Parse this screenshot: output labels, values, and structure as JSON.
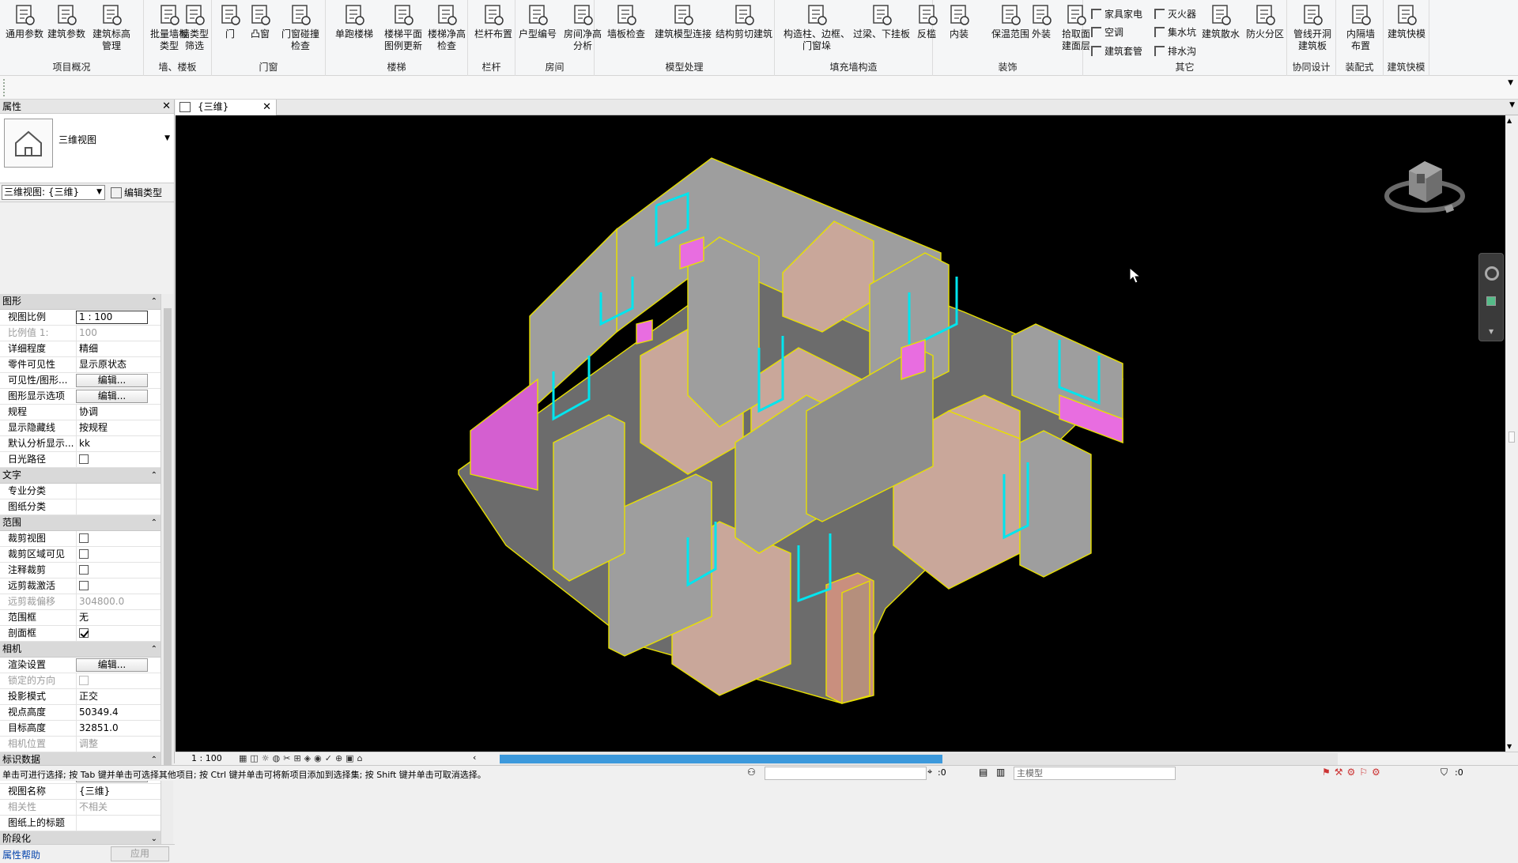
{
  "ribbon": {
    "groups": [
      {
        "label": "项目概况",
        "buttons": [
          "通用参数",
          "建筑参数",
          "建筑标高\n管理"
        ]
      },
      {
        "label": "墙、楼板",
        "buttons": [
          "批量墙板\n类型",
          "墙类型\n筛选"
        ]
      },
      {
        "label": "门窗",
        "buttons": [
          "门",
          "凸窗",
          "门窗碰撞\n检查"
        ]
      },
      {
        "label": "楼梯",
        "buttons": [
          "单跑楼梯",
          "楼梯平面\n图例更新",
          "楼梯净高\n检查"
        ]
      },
      {
        "label": "栏杆",
        "buttons": [
          "栏杆布置"
        ]
      },
      {
        "label": "房间",
        "buttons": [
          "户型编号",
          "房间净高\n分析"
        ]
      },
      {
        "label": "模型处理",
        "buttons": [
          "墙板检查",
          "建筑模型连接",
          "结构剪切建筑"
        ]
      },
      {
        "label": "填充墙构造",
        "buttons": [
          "构造柱、边框、\n门窗垛",
          "过梁、下挂板",
          "反槛"
        ]
      },
      {
        "label": "装饰",
        "buttons": [
          "内装",
          "保温范围",
          "外装",
          "拾取面\n建面层"
        ]
      },
      {
        "label": "其它",
        "small": [
          "家具家电",
          "空调",
          "建筑套管",
          "灭火器",
          "集水坑",
          "排水沟"
        ],
        "buttons": [
          "建筑散水",
          "防火分区"
        ]
      },
      {
        "label": "协同设计",
        "buttons": [
          "管线开洞\n建筑板"
        ]
      },
      {
        "label": "装配式",
        "buttons": [
          "内隔墙\n布置"
        ]
      },
      {
        "label": "建筑快模",
        "buttons": [
          "建筑快模"
        ]
      }
    ]
  },
  "properties": {
    "title": "属性",
    "type_name": "三维视图",
    "view_selector": "三维视图: {三维}",
    "edit_type": "编辑类型",
    "sections": [
      {
        "name": "图形",
        "rows": [
          {
            "k": "视图比例",
            "v": "1 : 100",
            "kind": "input"
          },
          {
            "k": "比例值 1:",
            "v": "100",
            "kind": "dis"
          },
          {
            "k": "详细程度",
            "v": "精细"
          },
          {
            "k": "零件可见性",
            "v": "显示原状态"
          },
          {
            "k": "可见性/图形...",
            "v": "编辑...",
            "kind": "btn"
          },
          {
            "k": "图形显示选项",
            "v": "编辑...",
            "kind": "btn"
          },
          {
            "k": "规程",
            "v": "协调"
          },
          {
            "k": "显示隐藏线",
            "v": "按规程"
          },
          {
            "k": "默认分析显示...",
            "v": "kk"
          },
          {
            "k": "日光路径",
            "v": "",
            "kind": "cb"
          }
        ]
      },
      {
        "name": "文字",
        "rows": [
          {
            "k": "专业分类",
            "v": ""
          },
          {
            "k": "图纸分类",
            "v": ""
          }
        ]
      },
      {
        "name": "范围",
        "rows": [
          {
            "k": "裁剪视图",
            "v": "",
            "kind": "cb"
          },
          {
            "k": "裁剪区域可见",
            "v": "",
            "kind": "cb"
          },
          {
            "k": "注释裁剪",
            "v": "",
            "kind": "cb"
          },
          {
            "k": "远剪裁激活",
            "v": "",
            "kind": "cb"
          },
          {
            "k": "远剪裁偏移",
            "v": "304800.0",
            "kind": "dis"
          },
          {
            "k": "范围框",
            "v": "无"
          },
          {
            "k": "剖面框",
            "v": "",
            "kind": "cbon"
          }
        ]
      },
      {
        "name": "相机",
        "rows": [
          {
            "k": "渲染设置",
            "v": "编辑...",
            "kind": "btn"
          },
          {
            "k": "锁定的方向",
            "v": "",
            "kind": "cbdis"
          },
          {
            "k": "投影模式",
            "v": "正交"
          },
          {
            "k": "视点高度",
            "v": "50349.4"
          },
          {
            "k": "目标高度",
            "v": "32851.0"
          },
          {
            "k": "相机位置",
            "v": "调整",
            "kind": "dis"
          }
        ]
      },
      {
        "name": "标识数据",
        "rows": [
          {
            "k": "视图样板",
            "v": "<无>",
            "kind": "btn"
          },
          {
            "k": "视图名称",
            "v": "{三维}"
          },
          {
            "k": "相关性",
            "v": "不相关",
            "kind": "dis"
          },
          {
            "k": "图纸上的标题",
            "v": ""
          }
        ]
      },
      {
        "name": "阶段化",
        "rows": []
      }
    ],
    "help": "属性帮助",
    "apply": "应用"
  },
  "view_tab": {
    "label": "{三维}"
  },
  "status": {
    "scale": "1 : 100",
    "message": "单击可进行选择; 按 Tab 键并单击可选择其他项目; 按 Ctrl 键并单击可将新项目添加到选择集; 按 Shift 键并单击可取消选择。",
    "selection_count": ":0",
    "workset": "主模型",
    "filter_count": ":0"
  },
  "colors": {
    "wall": "#9e9e9e",
    "interior": "#c9a79a",
    "edge": "#e8e000",
    "glass": "#00e5ee",
    "accent": "#e86de0",
    "scroll": "#3c99dc"
  }
}
